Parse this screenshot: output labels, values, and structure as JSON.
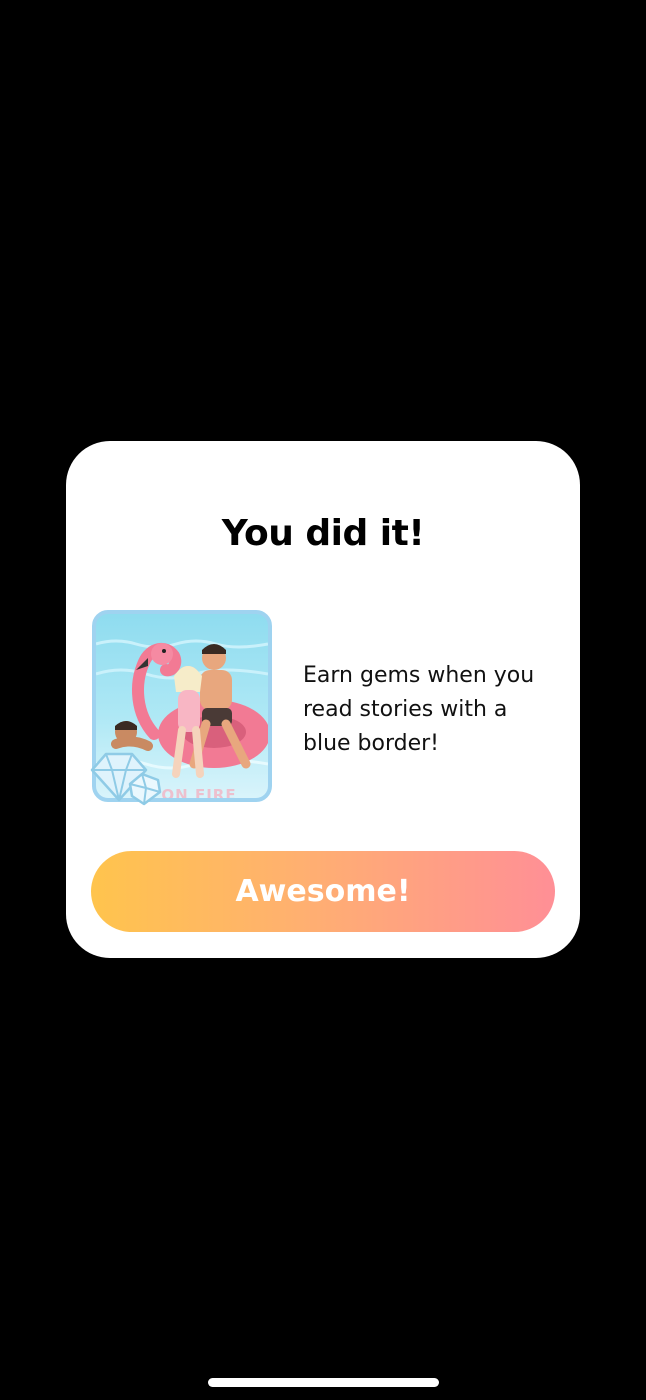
{
  "modal": {
    "title": "You did it!",
    "message": "Earn gems when you read stories with a blue border!",
    "cover_caption": "ON FIRE",
    "button_label": "Awesome!"
  },
  "icons": {
    "gem": "gem-icon",
    "cover": "story-cover-art"
  },
  "colors": {
    "background": "#000000",
    "modal": "#ffffff",
    "cover_border": "#9fd3f0",
    "button_gradient_start": "#ffc44d",
    "button_gradient_end": "#ff8f96"
  }
}
